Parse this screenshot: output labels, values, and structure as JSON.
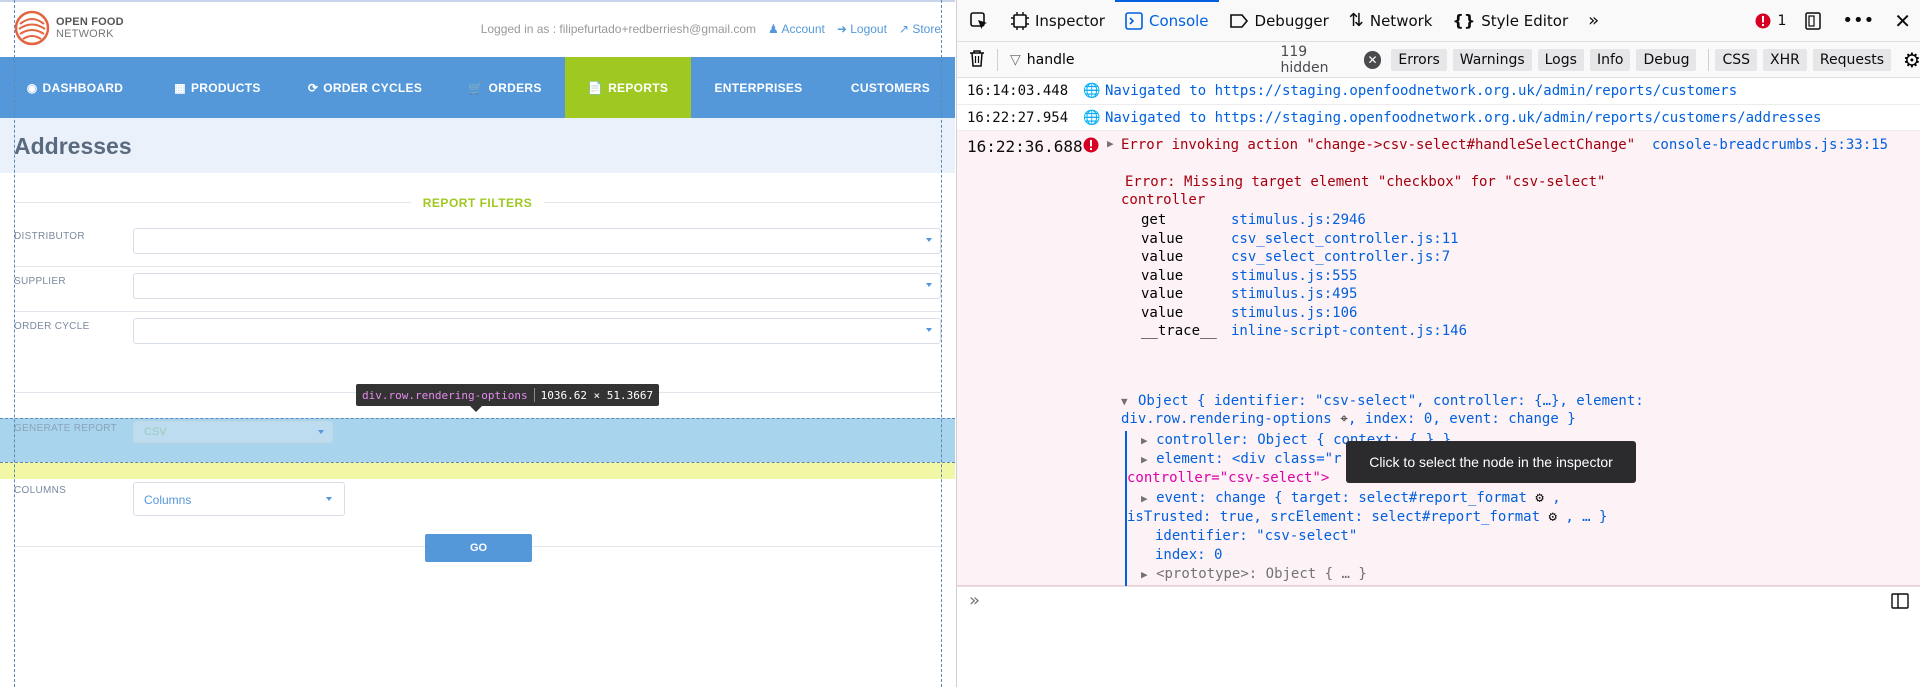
{
  "brand": {
    "line1": "OPEN FOOD",
    "line2": "NETWORK"
  },
  "userbar": {
    "logged_in": "Logged in as : filipefurtado+redberriesh@gmail.com",
    "account": "Account",
    "logout": "Logout",
    "store": "Store"
  },
  "nav": [
    "DASHBOARD",
    "PRODUCTS",
    "ORDER CYCLES",
    "ORDERS",
    "REPORTS",
    "ENTERPRISES",
    "CUSTOMERS"
  ],
  "nav_active": "REPORTS",
  "page_title": "Addresses",
  "filters": {
    "heading": "REPORT FILTERS",
    "distributor": "DISTRIBUTOR",
    "supplier": "SUPPLIER",
    "order_cycle": "ORDER CYCLE"
  },
  "generate": {
    "label": "GENERATE REPORT",
    "format": "CSV"
  },
  "columns": {
    "label": "COLUMNS",
    "value": "Columns"
  },
  "go": "GO",
  "highlight_tip": {
    "selector": "div.row.rendering-options",
    "size": "1036.62 × 51.3667"
  },
  "devtools": {
    "tabs": [
      "Inspector",
      "Console",
      "Debugger",
      "Network",
      "Style Editor"
    ],
    "active_tab": "Console",
    "error_count": "1",
    "filter_text": "handle",
    "hidden": "119 hidden",
    "filter_buttons": [
      "Errors",
      "Warnings",
      "Logs",
      "Info",
      "Debug"
    ],
    "type_buttons": [
      "CSS",
      "XHR",
      "Requests"
    ],
    "logs": [
      {
        "time": "16:14:03.448",
        "text": "Navigated to https://staging.openfoodnetwork.org.uk/admin/reports/customers"
      },
      {
        "time": "16:22:27.954",
        "text": "Navigated to https://staging.openfoodnetwork.org.uk/admin/reports/customers/addresses"
      }
    ],
    "error": {
      "time": "16:22:36.688",
      "title": "Error invoking action \"change->csv-select#handleSelectChange\"",
      "source": "console-breadcrumbs.js:33:15",
      "message1": "Error: Missing target element \"checkbox\" for \"csv-select\"",
      "message2": "controller",
      "stack": [
        {
          "fn": "get",
          "loc": "stimulus.js:2946"
        },
        {
          "fn": "value",
          "loc": "csv_select_controller.js:11"
        },
        {
          "fn": "value",
          "loc": "csv_select_controller.js:7"
        },
        {
          "fn": "value",
          "loc": "stimulus.js:555"
        },
        {
          "fn": "value",
          "loc": "stimulus.js:495"
        },
        {
          "fn": "value",
          "loc": "stimulus.js:106"
        },
        {
          "fn": "__trace__",
          "loc": "inline-script-content.js:146"
        }
      ],
      "object_line1": "Object { identifier: \"csv-select\", controller: {…}, element:",
      "object_line2a": "div.row.rendering-options",
      "object_line2b": ", index: 0, event: change }",
      "controller_line": "controller: Object { context: {…} }",
      "element_line": "element: <div class=\"r",
      "element_line2": "controller=\"csv-select\">",
      "event_line": "event: change { target: select#report_format",
      "event_line2a": "isTrusted: true, srcElement: select#report_format",
      "event_line2b": ", … }",
      "identifier_line": "identifier: \"csv-select\"",
      "index_line": "index: 0",
      "proto_line": "<prototype>: Object { … }"
    },
    "node_tooltip": "Click to select the node in the inspector"
  }
}
